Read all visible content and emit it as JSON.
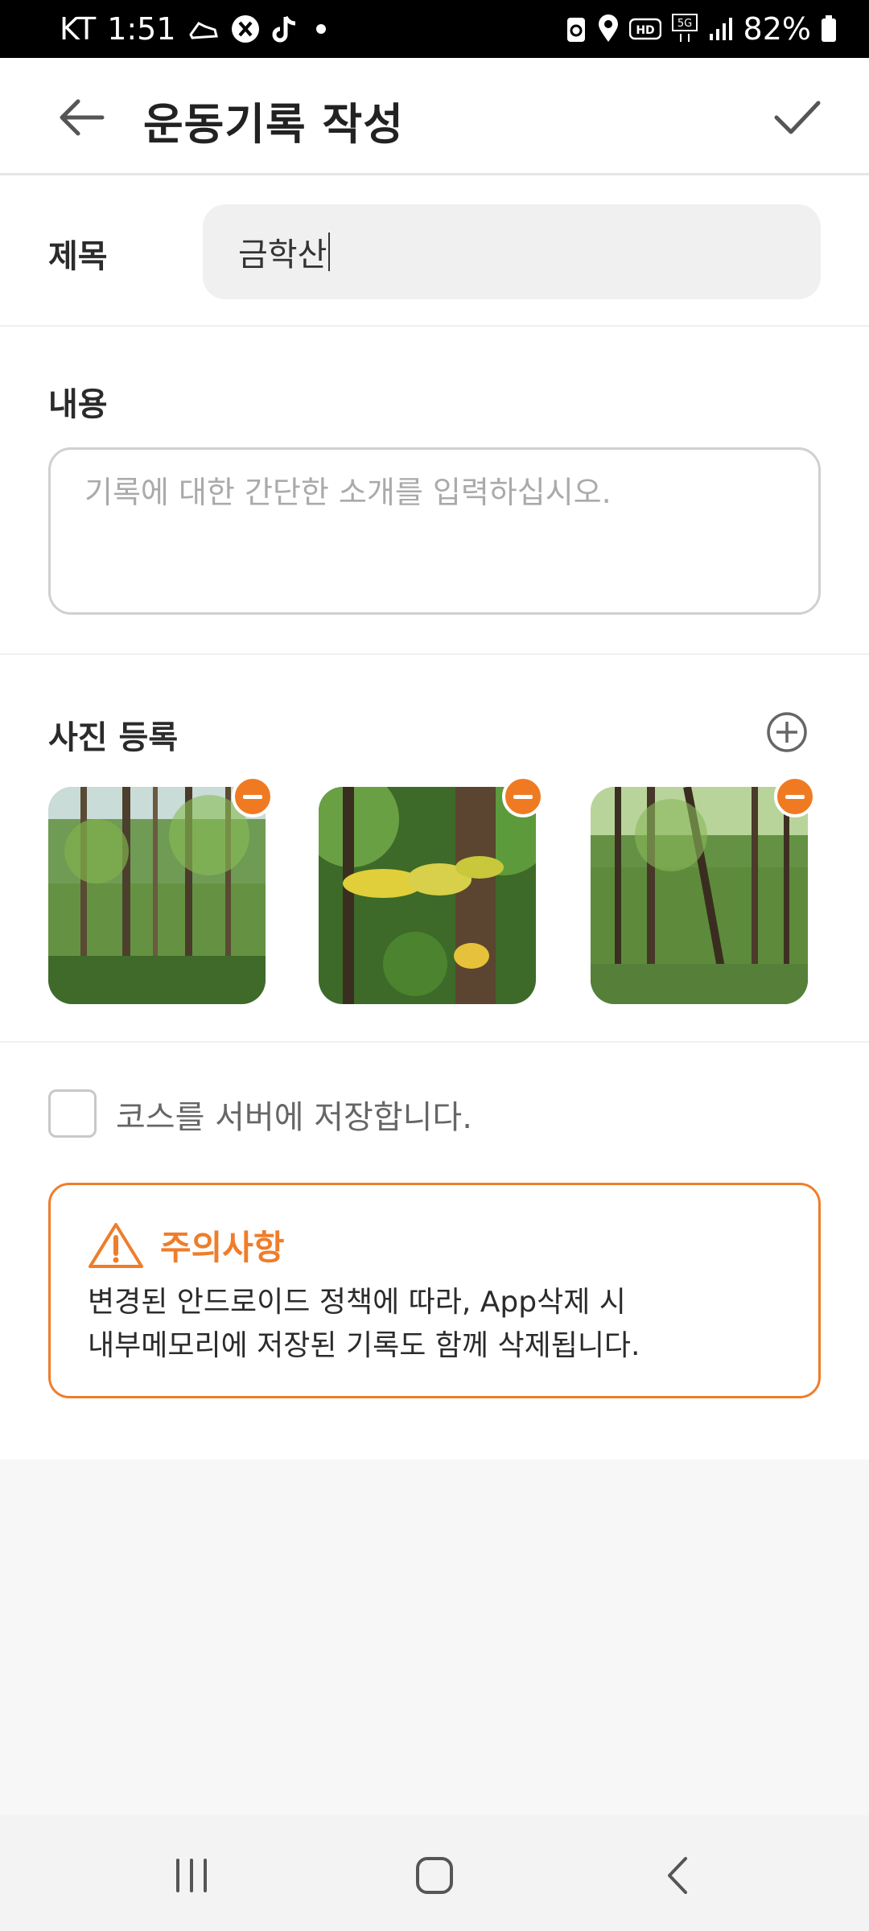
{
  "status_bar": {
    "carrier": "KT",
    "time": "1:51",
    "battery": "82%",
    "network": "5G",
    "hd": "HD"
  },
  "app_bar": {
    "title": "운동기록 작성"
  },
  "form": {
    "title_label": "제목",
    "title_value": "금학산",
    "content_label": "내용",
    "content_placeholder": "기록에 대한 간단한 소개를 입력하십시오.",
    "photos_label": "사진 등록",
    "photos": [
      {
        "alt": "forest-photo-1"
      },
      {
        "alt": "forest-photo-2"
      },
      {
        "alt": "forest-photo-3"
      }
    ],
    "save_course_label": "코스를 서버에 저장합니다.",
    "save_course_checked": false
  },
  "notice": {
    "title": "주의사항",
    "line1": "변경된 안드로이드 정책에 따라, App삭제 시",
    "line2": "내부메모리에 저장된 기록도 함께 삭제됩니다."
  },
  "colors": {
    "accent": "#ef7d2a",
    "input_bg": "#f0f0f0",
    "border": "#d0d0d0"
  },
  "nav": {
    "icons": [
      "recents-icon",
      "home-icon",
      "back-icon"
    ]
  }
}
